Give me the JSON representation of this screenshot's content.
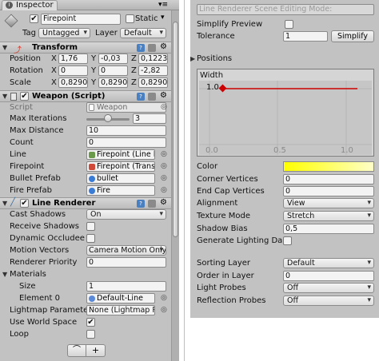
{
  "inspector": {
    "tab_label": "Inspector",
    "object": {
      "name": "Firepoint",
      "static_label": "Static",
      "tag_label": "Tag",
      "tag_value": "Untagged",
      "layer_label": "Layer",
      "layer_value": "Default"
    },
    "transform": {
      "title": "Transform",
      "rows": [
        {
          "label": "Position",
          "x": "1,76",
          "y": "-0,03",
          "z": "0,1223"
        },
        {
          "label": "Rotation",
          "x": "0",
          "y": "0",
          "z": "-2,82"
        },
        {
          "label": "Scale",
          "x": "0,8290",
          "y": "0,8290",
          "z": "0,8290"
        }
      ],
      "axis_x": "X",
      "axis_y": "Y",
      "axis_z": "Z"
    },
    "weapon": {
      "title": "Weapon (Script)",
      "script_label": "Script",
      "script_value": "Weapon",
      "max_iterations_label": "Max Iterations",
      "max_iterations_value": "3",
      "max_distance_label": "Max Distance",
      "max_distance_value": "10",
      "count_label": "Count",
      "count_value": "0",
      "line_label": "Line",
      "line_value": "Firepoint (Line R",
      "firepoint_label": "Firepoint",
      "firepoint_value": "Firepoint (Trans",
      "bullet_prefab_label": "Bullet Prefab",
      "bullet_prefab_value": "bullet",
      "fire_prefab_label": "Fire Prefab",
      "fire_prefab_value": "Fire"
    },
    "line_renderer": {
      "title": "Line Renderer",
      "cast_shadows_label": "Cast Shadows",
      "cast_shadows_value": "On",
      "receive_shadows_label": "Receive Shadows",
      "dynamic_occludee_label": "Dynamic Occludee",
      "motion_vectors_label": "Motion Vectors",
      "motion_vectors_value": "Camera Motion Only",
      "renderer_priority_label": "Renderer Priority",
      "renderer_priority_value": "0",
      "materials_label": "Materials",
      "size_label": "Size",
      "size_value": "1",
      "element0_label": "Element 0",
      "element0_value": "Default-Line",
      "lightmap_label": "Lightmap Parameter",
      "lightmap_value": "None (Lightmap P",
      "use_world_space_label": "Use World Space",
      "loop_label": "Loop",
      "add_symbol": "+"
    }
  },
  "right_panel": {
    "scene_editing_mode": "Line Renderer Scene Editing Mode:",
    "simplify_preview_label": "Simplify Preview",
    "tolerance_label": "Tolerance",
    "tolerance_value": "1",
    "simplify_button": "Simplify",
    "positions_label": "Positions",
    "width_label": "Width",
    "width_y_tick": "1.0",
    "width_x_ticks": [
      "0.0",
      "0.5",
      "1.0"
    ],
    "color_label": "Color",
    "corner_vertices_label": "Corner Vertices",
    "corner_vertices_value": "0",
    "end_cap_vertices_label": "End Cap Vertices",
    "end_cap_vertices_value": "0",
    "alignment_label": "Alignment",
    "alignment_value": "View",
    "texture_mode_label": "Texture Mode",
    "texture_mode_value": "Stretch",
    "shadow_bias_label": "Shadow Bias",
    "shadow_bias_value": "0,5",
    "generate_lighting_label": "Generate Lighting Da",
    "sorting_layer_label": "Sorting Layer",
    "sorting_layer_value": "Default",
    "order_in_layer_label": "Order in Layer",
    "order_in_layer_value": "0",
    "light_probes_label": "Light Probes",
    "light_probes_value": "Off",
    "reflection_probes_label": "Reflection Probes",
    "reflection_probes_value": "Off"
  },
  "colors": {
    "panel_bg": "#c2c2c2",
    "color_gradient_start": "#ffff00",
    "color_gradient_end": "#ffffc8",
    "width_curve": "#cc0000"
  }
}
